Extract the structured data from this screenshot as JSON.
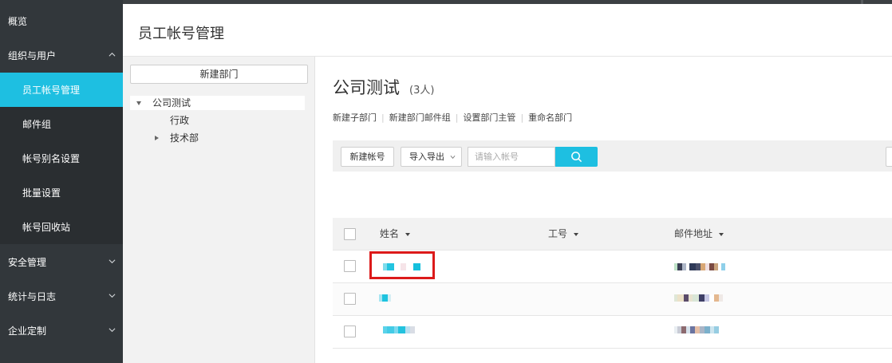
{
  "sidebar": {
    "items": [
      {
        "label": "概览",
        "type": "top"
      },
      {
        "label": "组织与用户",
        "type": "top",
        "chevron": "up"
      },
      {
        "label": "员工帐号管理",
        "type": "sub",
        "active": true
      },
      {
        "label": "邮件组",
        "type": "sub"
      },
      {
        "label": "帐号别名设置",
        "type": "sub"
      },
      {
        "label": "批量设置",
        "type": "sub"
      },
      {
        "label": "帐号回收站",
        "type": "sub"
      },
      {
        "label": "安全管理",
        "type": "top",
        "chevron": "down"
      },
      {
        "label": "统计与日志",
        "type": "top",
        "chevron": "down"
      },
      {
        "label": "企业定制",
        "type": "top",
        "chevron": "down"
      }
    ]
  },
  "header": {
    "title": "员工帐号管理"
  },
  "tree": {
    "new_dept_label": "新建部门",
    "nodes": [
      {
        "label": "公司测试",
        "expanded": true,
        "selected": true
      },
      {
        "label": "行政"
      },
      {
        "label": "技术部",
        "collapsed": true
      }
    ]
  },
  "main": {
    "dept_name": "公司测试",
    "member_count": "(3人)",
    "actions": [
      "新建子部门",
      "新建部门邮件组",
      "设置部门主管",
      "重命名部门"
    ],
    "toolbar": {
      "new_account": "新建帐号",
      "import_export": "导入导出",
      "search_placeholder": "请输入帐号"
    },
    "table": {
      "columns": [
        "姓名",
        "工号",
        "邮件地址"
      ],
      "rows": [
        {
          "name": "[blurred]",
          "emp_id": "",
          "email": "[blurred]",
          "highlighted": true
        },
        {
          "name": "[blurred]",
          "emp_id": "",
          "email": "[blurred]"
        },
        {
          "name": "[blurred]",
          "emp_id": "",
          "email": "[blurred]"
        }
      ]
    }
  },
  "colors": {
    "sidebar_bg": "#32373b",
    "active": "#1ebfe1",
    "highlight_box": "#dc1a1a"
  }
}
